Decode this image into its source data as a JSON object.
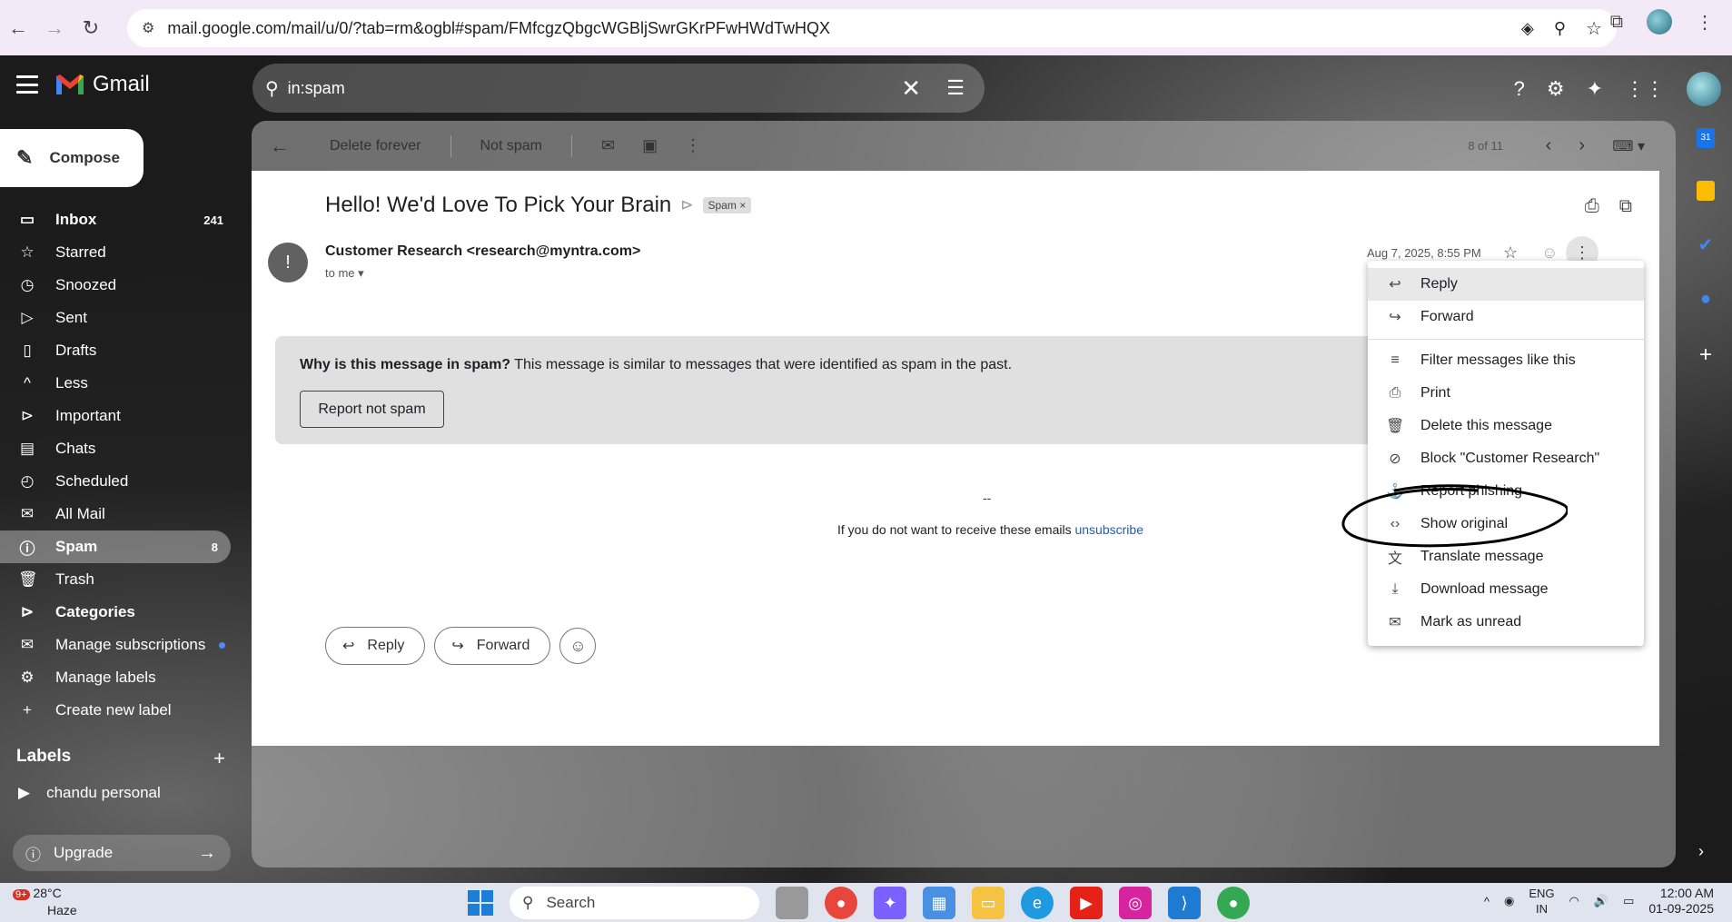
{
  "browser": {
    "url": "mail.google.com/mail/u/0/?tab=rm&ogbl#spam/FMfcgzQbgcWGBljSwrGKrPFwHWdTwHQX"
  },
  "gmail": {
    "app_name": "Gmail",
    "search_value": "in:spam",
    "compose_label": "Compose"
  },
  "sidebar": {
    "items": [
      {
        "label": "Inbox",
        "count": "241",
        "icon": "inbox-icon"
      },
      {
        "label": "Starred",
        "count": "",
        "icon": "star-icon"
      },
      {
        "label": "Snoozed",
        "count": "",
        "icon": "clock-icon"
      },
      {
        "label": "Sent",
        "count": "",
        "icon": "send-icon"
      },
      {
        "label": "Drafts",
        "count": "",
        "icon": "draft-icon"
      },
      {
        "label": "Less",
        "count": "",
        "icon": "chevron-up-icon"
      },
      {
        "label": "Important",
        "count": "",
        "icon": "label-important-icon"
      },
      {
        "label": "Chats",
        "count": "",
        "icon": "chat-icon"
      },
      {
        "label": "Scheduled",
        "count": "",
        "icon": "schedule-icon"
      },
      {
        "label": "All Mail",
        "count": "",
        "icon": "all-mail-icon"
      },
      {
        "label": "Spam",
        "count": "8",
        "icon": "spam-icon"
      },
      {
        "label": "Trash",
        "count": "",
        "icon": "trash-icon"
      },
      {
        "label": "Categories",
        "count": "",
        "icon": "label-icon"
      },
      {
        "label": "Manage subscriptions",
        "count": "",
        "icon": "subscriptions-icon"
      },
      {
        "label": "Manage labels",
        "count": "",
        "icon": "gear-icon"
      },
      {
        "label": "Create new label",
        "count": "",
        "icon": "plus-icon"
      }
    ],
    "labels_heading": "Labels",
    "label_items": [
      "chandu personal"
    ],
    "upgrade_label": "Upgrade"
  },
  "toolbar": {
    "delete_forever": "Delete forever",
    "not_spam": "Not spam",
    "pager": "8 of 11"
  },
  "message": {
    "subject": "Hello! We'd Love To Pick Your Brain",
    "spam_chip": "Spam",
    "sender": "Customer Research <research@myntra.com>",
    "to": "to me",
    "date": "Aug 7, 2025, 8:55 PM",
    "spam_heading": "Why is this message in spam?",
    "spam_reason": " This message is similar to messages that were identified as spam in the past.",
    "report_not_spam": "Report not spam",
    "signature": "--",
    "unsubscribe_text": "If you do not want to receive these emails ",
    "unsubscribe_link": "unsubscribe",
    "reply_label": "Reply",
    "forward_label": "Forward"
  },
  "menu": {
    "items": [
      {
        "label": "Reply",
        "icon": "reply-icon"
      },
      {
        "label": "Forward",
        "icon": "forward-icon"
      },
      {
        "label": "Filter messages like this",
        "icon": "filter-icon"
      },
      {
        "label": "Print",
        "icon": "print-icon"
      },
      {
        "label": "Delete this message",
        "icon": "trash-icon"
      },
      {
        "label": "Block \"Customer Research\"",
        "icon": "block-icon"
      },
      {
        "label": "Report phishing",
        "icon": "phishing-icon"
      },
      {
        "label": "Show original",
        "icon": "code-icon"
      },
      {
        "label": "Translate message",
        "icon": "translate-icon"
      },
      {
        "label": "Download message",
        "icon": "download-icon"
      },
      {
        "label": "Mark as unread",
        "icon": "mark-unread-icon"
      }
    ]
  },
  "taskbar": {
    "temp": "28°C",
    "weather": "Haze",
    "weather_badge": "9+",
    "search": "Search",
    "lang": "ENG",
    "region": "IN",
    "time": "12:00 AM",
    "date": "01-09-2025"
  }
}
